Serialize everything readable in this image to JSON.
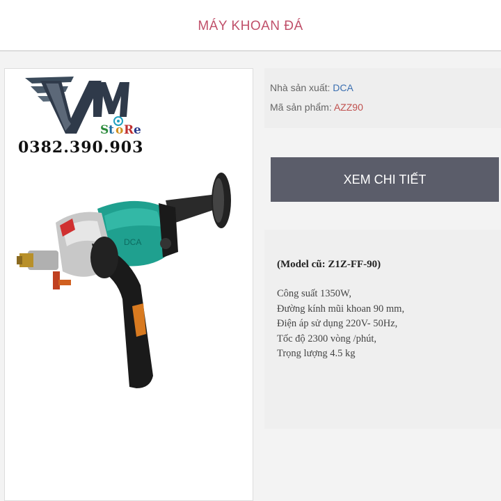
{
  "header": {
    "title": "MÁY KHOAN ĐÁ"
  },
  "logo": {
    "brand": "VM",
    "tagline": "StoRe",
    "phone": "0382.390.903"
  },
  "product": {
    "manufacturer_label": "Nhà sản xuất:",
    "manufacturer": "DCA",
    "code_label": "Mã sản phẩm:",
    "code": "AZZ90",
    "detail_button": "XEM CHI TIẾT",
    "model_note": "(Model cũ: Z1Z-FF-90)",
    "specs": [
      "Công suất 1350W,",
      "Đường kính mũi khoan 90 mm,",
      "Điện áp sử dụng 220V- 50Hz,",
      "Tốc độ 2300 vòng /phút,",
      "Trọng lượng 4.5 kg"
    ],
    "image_label": "DCA"
  },
  "colors": {
    "title": "#c0506a",
    "button": "#5b5d6a",
    "brand_link": "#3b6fb0",
    "code": "#c0504e",
    "tool_body": "#1fa08f"
  },
  "icons": {
    "logo": "vm-store-logo-icon",
    "product": "rock-drill-image"
  }
}
